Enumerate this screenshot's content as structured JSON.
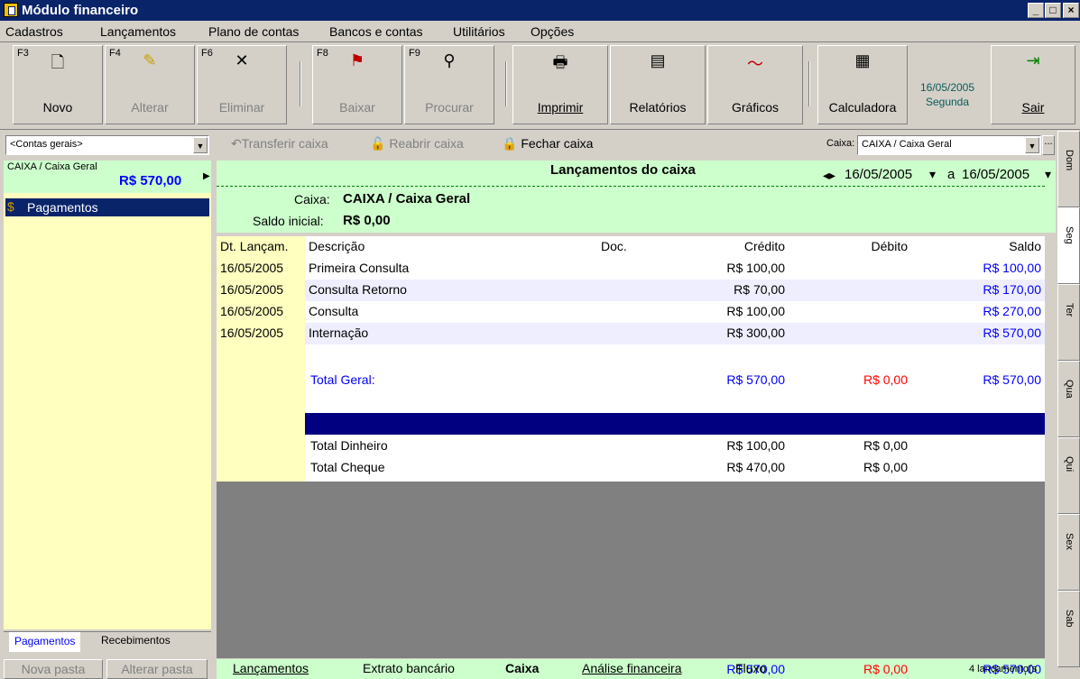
{
  "window": {
    "title": "Módulo financeiro",
    "min": "_",
    "max": "□",
    "close": "×"
  },
  "menu": [
    "Cadastros",
    "Lançamentos",
    "Plano de contas",
    "Bancos e contas",
    "Utilitários",
    "Opções"
  ],
  "toolbar": {
    "novo": {
      "key": "F3",
      "label": "Novo"
    },
    "alterar": {
      "key": "F4",
      "label": "Alterar"
    },
    "eliminar": {
      "key": "F6",
      "label": "Eliminar"
    },
    "baixar": {
      "key": "F8",
      "label": "Baixar"
    },
    "procurar": {
      "key": "F9",
      "label": "Procurar"
    },
    "imprimir": "Imprimir",
    "relatorios": "Relatórios",
    "graficos": "Gráficos",
    "calculadora": "Calculadora",
    "date": "16/05/2005",
    "weekday": "Segunda",
    "sair": "Sair"
  },
  "left": {
    "combo": "<Contas gerais>",
    "account_name": "CAIXA / Caixa Geral",
    "account_balance": "R$ 570,00",
    "tree_item": "Pagamentos",
    "tabs": [
      "Pagamentos",
      "Recebimentos"
    ],
    "nova_pasta": "Nova pasta",
    "alterar_pasta": "Alterar pasta"
  },
  "main": {
    "transferir": "Transferir caixa",
    "reabrir": "Reabrir caixa",
    "fechar": "Fechar caixa",
    "caixa_label": "Caixa:",
    "caixa_value": "CAIXA / Caixa Geral",
    "header_title": "Lançamentos do caixa",
    "date_from": "16/05/2005",
    "date_sep": "a",
    "date_to": "16/05/2005",
    "caixa_info_label": "Caixa:",
    "caixa_info_value": "CAIXA / Caixa Geral",
    "saldo_label": "Saldo inicial:",
    "saldo_value": "R$ 0,00",
    "columns": [
      "Dt. Lançam.",
      "Descrição",
      "Doc.",
      "Crédito",
      "Débito",
      "Saldo"
    ],
    "rows": [
      {
        "date": "16/05/2005",
        "desc": "Primeira Consulta",
        "doc": "",
        "credit": "R$ 100,00",
        "debit": "",
        "saldo": "R$ 100,00"
      },
      {
        "date": "16/05/2005",
        "desc": "Consulta Retorno",
        "doc": "",
        "credit": "R$ 70,00",
        "debit": "",
        "saldo": "R$ 170,00"
      },
      {
        "date": "16/05/2005",
        "desc": "Consulta",
        "doc": "",
        "credit": "R$ 100,00",
        "debit": "",
        "saldo": "R$ 270,00"
      },
      {
        "date": "16/05/2005",
        "desc": "Internação",
        "doc": "",
        "credit": "R$ 300,00",
        "debit": "",
        "saldo": "R$ 570,00"
      }
    ],
    "total_geral": {
      "label": "Total Geral:",
      "credit": "R$ 570,00",
      "debit": "R$ 0,00",
      "saldo": "R$ 570,00"
    },
    "total_dinheiro": {
      "label": "Total Dinheiro",
      "credit": "R$ 100,00",
      "debit": "R$ 0,00"
    },
    "total_cheque": {
      "label": "Total Cheque",
      "credit": "R$ 470,00",
      "debit": "R$ 0,00"
    },
    "footer": {
      "credit": "R$ 570,00",
      "debit": "R$ 0,00",
      "saldo": "R$ 570,00"
    },
    "tabs": [
      "Lançamentos",
      "Extrato bancário",
      "Caixa",
      "Análise financeira",
      "Fluxo"
    ],
    "status": "4 lancamento(s"
  },
  "weekdays": [
    "Dom",
    "Seg",
    "Ter",
    "Qua",
    "Qui",
    "Sex",
    "Sab"
  ],
  "colors": {
    "title": "#0a246a",
    "header_green": "#ccffcc",
    "tree_bg": "#ffffc0",
    "row_alt": "#eeeeff"
  }
}
